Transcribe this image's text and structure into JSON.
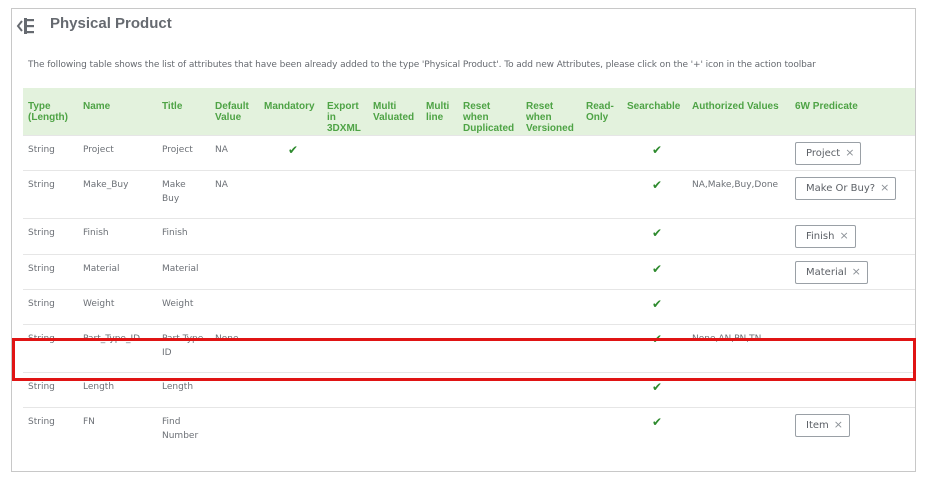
{
  "header": {
    "back_icon": "collapse-left-icon",
    "title": "Physical Product"
  },
  "description": "The following table shows the list of attributes that have been already added to the type 'Physical Product'. To add new Attributes, please click on the '+' icon in the action toolbar",
  "table": {
    "columns": [
      {
        "key": "type",
        "lines": [
          "Type",
          "(Length)"
        ]
      },
      {
        "key": "name",
        "lines": [
          "Name"
        ]
      },
      {
        "key": "title",
        "lines": [
          "Title"
        ]
      },
      {
        "key": "default_value",
        "lines": [
          "Default",
          "Value"
        ]
      },
      {
        "key": "mandatory",
        "lines": [
          "Mandatory"
        ]
      },
      {
        "key": "export_3dxml",
        "lines": [
          "Export",
          "in",
          "3DXML"
        ]
      },
      {
        "key": "multi_valued",
        "lines": [
          "Multi",
          "Valuated"
        ]
      },
      {
        "key": "multi_line",
        "lines": [
          "Multi",
          "line"
        ]
      },
      {
        "key": "reset_duplicated",
        "lines": [
          "Reset",
          "when",
          "Duplicated"
        ]
      },
      {
        "key": "reset_versioned",
        "lines": [
          "Reset",
          "when",
          "Versioned"
        ]
      },
      {
        "key": "read_only",
        "lines": [
          "Read-",
          "Only"
        ]
      },
      {
        "key": "searchable",
        "lines": [
          "Searchable"
        ]
      },
      {
        "key": "authorized_values",
        "lines": [
          "Authorized Values"
        ]
      },
      {
        "key": "predicate_6w",
        "lines": [
          "6W Predicate"
        ]
      }
    ],
    "check_glyph": "✔",
    "tag_close_glyph": "×",
    "rows": [
      {
        "type": "String",
        "name": "Project",
        "title": "Project",
        "default_value": "NA",
        "mandatory": true,
        "searchable": true,
        "authorized_values": "",
        "predicate_6w": "Project"
      },
      {
        "type": "String",
        "name": "Make_Buy",
        "title": "Make Buy",
        "default_value": "NA",
        "mandatory": false,
        "searchable": true,
        "authorized_values": "NA,Make,Buy,Done",
        "predicate_6w": "Make Or Buy?"
      },
      {
        "type": "String",
        "name": "Finish",
        "title": "Finish",
        "default_value": "",
        "mandatory": false,
        "searchable": true,
        "authorized_values": "",
        "predicate_6w": "Finish"
      },
      {
        "type": "String",
        "name": "Material",
        "title": "Material",
        "default_value": "",
        "mandatory": false,
        "searchable": true,
        "authorized_values": "",
        "predicate_6w": "Material"
      },
      {
        "type": "String",
        "name": "Weight",
        "title": "Weight",
        "default_value": "",
        "mandatory": false,
        "searchable": true,
        "authorized_values": "",
        "predicate_6w": ""
      },
      {
        "type": "String",
        "name": "Part_Type_ID",
        "title": "Part Type ID",
        "default_value": "None",
        "mandatory": false,
        "searchable": true,
        "authorized_values": "None,AN,PN,TN",
        "predicate_6w": "",
        "highlighted": true
      },
      {
        "type": "String",
        "name": "Length",
        "title": "Length",
        "default_value": "",
        "mandatory": false,
        "searchable": true,
        "authorized_values": "",
        "predicate_6w": ""
      },
      {
        "type": "String",
        "name": "FN",
        "title": "Find Number",
        "default_value": "",
        "mandatory": false,
        "searchable": true,
        "authorized_values": "",
        "predicate_6w": "Item"
      }
    ]
  },
  "colors": {
    "header_bg": "#e3f2dd",
    "header_text": "#4ea345",
    "check": "#2d8a2d",
    "highlight_border": "#e01414"
  }
}
